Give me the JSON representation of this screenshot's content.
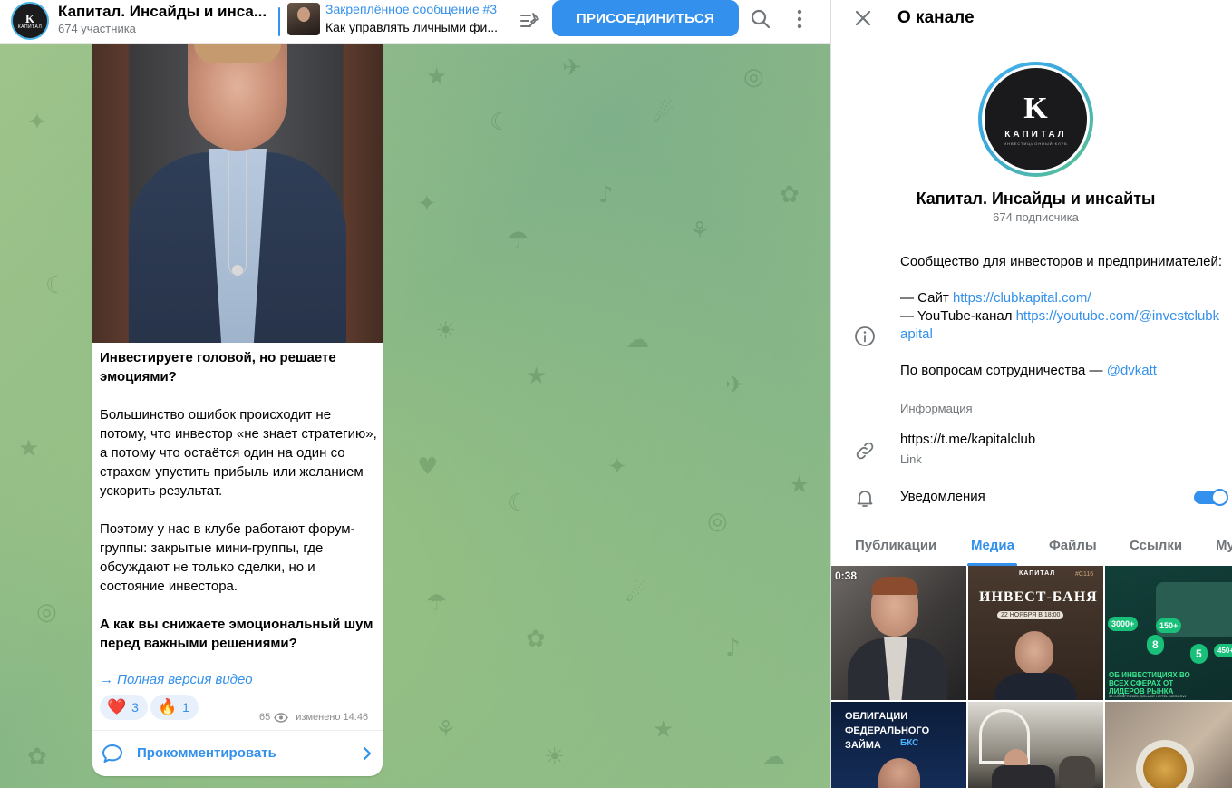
{
  "header": {
    "channel_title": "Капитал. Инсайды и инса...",
    "members": "674 участника",
    "avatar_letter": "K",
    "avatar_text": "КАПИТАЛ",
    "pinned_title": "Закреплённое сообщение #3",
    "pinned_text": "Как управлять личными фи...",
    "join_label": "ПРИСОЕДИНИТЬСЯ"
  },
  "message": {
    "title": "Инвестируете головой, но решаете эмоциями?",
    "p1": "Большинство ошибок происходит не потому, что инвестор «не знает стратегию», а потому что остаётся один на один со страхом упустить прибыль или желанием ускорить результат.",
    "p2": "Поэтому у нас в клубе работают форум-группы: закрытые мини-группы, где обсуждают не только сделки, но и состояние инвестора.",
    "question": "А как вы снижаете эмоциональный шум перед важными решениями?",
    "full_link": "→ Полная версия видео",
    "reactions": [
      {
        "emoji": "❤️",
        "count": "3"
      },
      {
        "emoji": "🔥",
        "count": "1"
      }
    ],
    "views": "65",
    "edited": "изменено 14:46",
    "comment_label": "Прокомментировать"
  },
  "panel": {
    "title": "О канале",
    "logo_letter": "K",
    "logo_brand": "КАПИТАЛ",
    "logo_tag": "ИНВЕСТИЦИОННЫЙ КЛУБ",
    "channel_name": "Капитал. Инсайды и инсайты",
    "subscribers": "674 подписчика",
    "desc_intro": "Сообщество для инвесторов и предпринимателей:",
    "site_prefix": "— Сайт ",
    "site_link": "https://clubkapital.com/",
    "youtube_prefix": "— YouTube-канал ",
    "youtube_link": "https://youtube.com/@investclubkapital",
    "coop_prefix": "По вопросам сотрудничества — ",
    "coop_link": "@dvkatt",
    "desc_caption": "Информация",
    "link_value": "https://t.me/kapitalclub",
    "link_caption": "Link",
    "notifications_label": "Уведомления",
    "notifications_on": true,
    "tabs": [
      "Публикации",
      "Медиа",
      "Файлы",
      "Ссылки",
      "Му"
    ],
    "active_tab": "Медиа",
    "media": {
      "video_duration": "0:38",
      "tile2_title": "ИНВЕСТ-БАНЯ",
      "tile2_brand": "КАПИТАЛ",
      "tile2_date": "22 НОЯБРЯ В 18:00",
      "tile2_tag": "#С116",
      "tile3_caption": "ОБ ИНВЕСТИЦИЯХ ВО ВСЕХ СФЕРАХ ОТ ЛИДЕРОВ РЫНКА",
      "tile3_numbers": [
        "3000+",
        "150+",
        "8",
        "5",
        "450+"
      ],
      "tile3_footer": "30 НОЯБРЯ 2025, SOLUXE HOTEL MOSCOW",
      "tile4_text": "ОБЛИГАЦИИ ФЕДЕРАЛЬНОГО ЗАЙМА",
      "tile4_brand": "БКС"
    }
  },
  "colors": {
    "accent": "#3390ec",
    "secondary_text": "#707579",
    "chat_bg": "#8ab887"
  }
}
